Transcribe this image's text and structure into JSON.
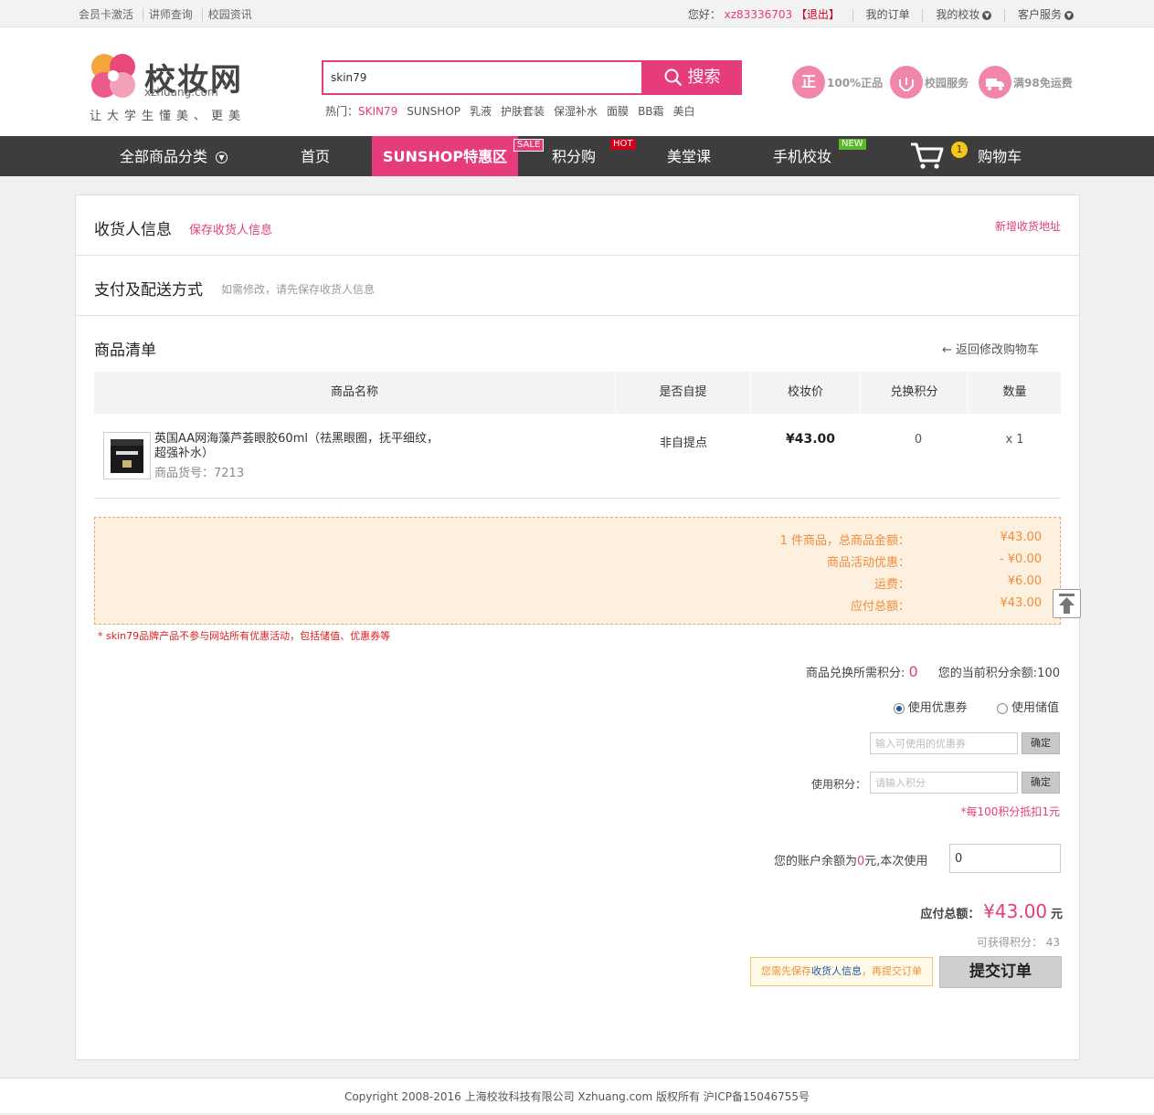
{
  "topbar": {
    "links": [
      "会员卡激活",
      "讲师查询",
      "校园资讯"
    ],
    "greeting": "您好：",
    "username": "xz83336703",
    "logout": "【退出】",
    "my_orders": "我的订单",
    "my_xzhuang": "我的校妆",
    "service": "客户服务"
  },
  "logo": {
    "name": "校妆网",
    "domain": "xzhuang.com",
    "slogan": "让大学生懂美、更美"
  },
  "search": {
    "value": "skin79",
    "button": "搜索",
    "hot_label": "热门：",
    "hot_keywords": [
      "SKIN79",
      "SUNSHOP",
      "乳液",
      "护肤套装",
      "保湿补水",
      "面膜",
      "BB霜",
      "美白"
    ]
  },
  "badges": [
    {
      "icon": "正",
      "label": "100%正品"
    },
    {
      "icon": "",
      "label": "校园服务"
    },
    {
      "icon": "",
      "label": "满98免运费"
    }
  ],
  "nav": {
    "all_categories": "全部商品分类",
    "home": "首页",
    "sunshop": "SUNSHOP特惠区",
    "sale_tag": "SALE",
    "points": "积分购",
    "hot_tag": "HOT",
    "class": "美堂课",
    "mobile": "手机校妆",
    "new_tag": "NEW",
    "cart": "购物车",
    "cart_count": "1"
  },
  "receiver": {
    "title": "收货人信息",
    "save_link": "保存收货人信息",
    "add_address": "新增收货地址"
  },
  "payment": {
    "title": "支付及配送方式",
    "hint": "如需修改，请先保存收货人信息"
  },
  "goods": {
    "title": "商品清单",
    "back_to_cart": "← 返回修改购物车",
    "headers": [
      "商品名称",
      "是否自提",
      "校妆价",
      "兑换积分",
      "数量"
    ],
    "items": [
      {
        "name_line1": "英国AA网海藻芦荟眼胶60ml（祛黑眼圈，抚平细纹，",
        "name_line2": "超强补水）",
        "sku": "商品货号：7213",
        "pickup": "非自提点",
        "price": "¥43.00",
        "points": "0",
        "qty": "x 1"
      }
    ]
  },
  "summary": {
    "rows": [
      {
        "k": "1 件商品，总商品金额：",
        "v": "¥43.00"
      },
      {
        "k": "商品活动优惠：",
        "v": "- ¥0.00"
      },
      {
        "k": "运费：",
        "v": "¥6.00"
      },
      {
        "k": "应付总额：",
        "v": "¥43.00"
      }
    ],
    "note": "* skin79品牌产品不参与网站所有优惠活动，包括储值、优惠券等"
  },
  "points_info": {
    "need_label": "商品兑换所需积分:",
    "need_value": "0",
    "balance": "您的当前积分余额:100"
  },
  "options": {
    "use_coupon": "使用优惠券",
    "use_stored": "使用储值",
    "coupon_placeholder": "输入可使用的优惠券",
    "confirm": "确定",
    "points_label": "使用积分：",
    "points_placeholder": "请输入积分",
    "points_rule": "*每100积分抵扣1元",
    "balance_text_a": "您的账户余额为",
    "balance_amount": "0",
    "balance_text_b": "元,本次使用",
    "balance_value": "0"
  },
  "total": {
    "label": "应付总额：",
    "amount": "¥43.00",
    "unit": "元",
    "earn_points": "可获得积分： 43",
    "notice_a": "您需先保存",
    "notice_b": "收货人信息",
    "notice_c": "，再提交订单",
    "submit": "提交订单"
  },
  "footer": {
    "text": "Copyright 2008-2016 上海校妆科技有限公司 Xzhuang.com 版权所有 沪ICP备15046755号"
  },
  "colors": {
    "brand": "#e63c7b",
    "nav_bg": "#3d3d3d",
    "summary_bg": "#fdf0df",
    "summary_text": "#f08c3b"
  }
}
